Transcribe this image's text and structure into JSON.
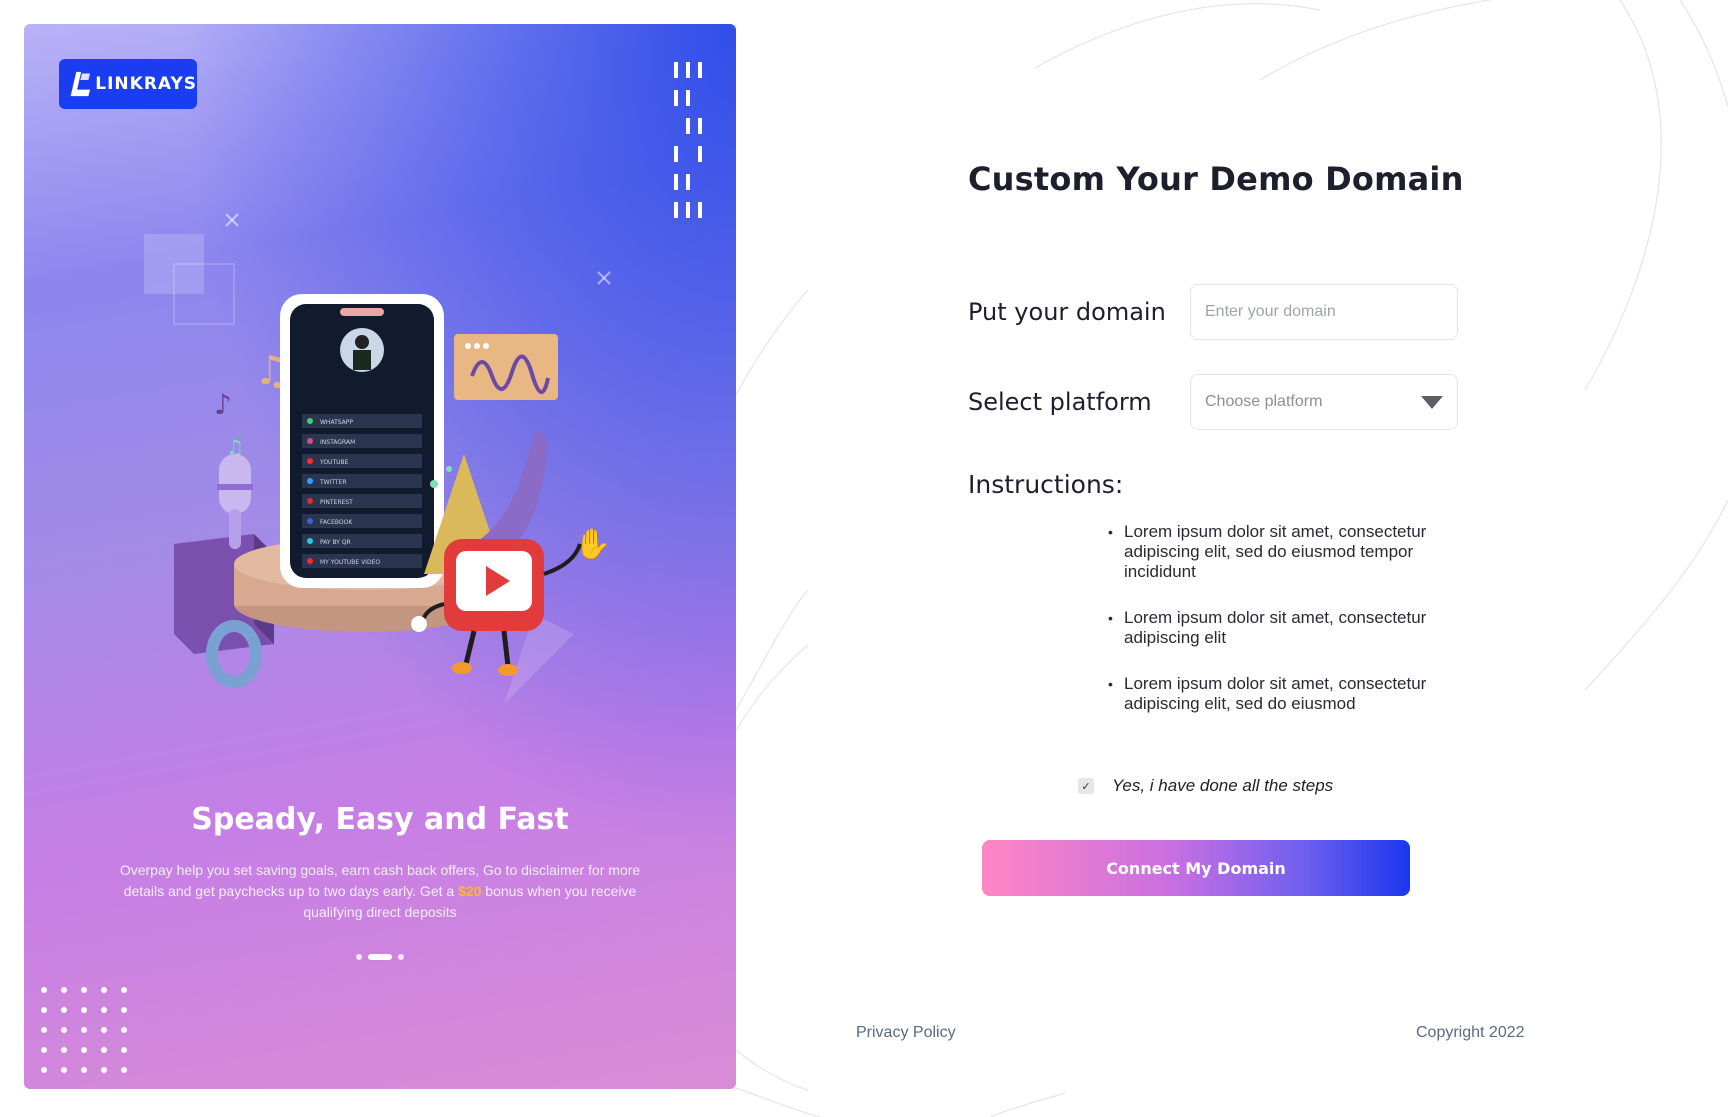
{
  "brand": {
    "name": "LINKRAYS"
  },
  "hero": {
    "title": "Speady, Easy and Fast",
    "description_before": "Overpay help you set saving goals, earn cash back offers, Go to disclaimer for more details and get paychecks up to two days early. Get a ",
    "bonus": "$20",
    "description_after": " bonus when you receive qualifying direct deposits",
    "carousel": {
      "total": 3,
      "active": 2
    },
    "phone_links": [
      "WHATSAPP",
      "INSTAGRAM",
      "YOUTUBE",
      "TWITTER",
      "PINTEREST",
      "FACEBOOK",
      "PAY BY QR",
      "MY YOUTUBE VIDEO"
    ]
  },
  "form": {
    "title": "Custom Your Demo Domain",
    "domain": {
      "label": "Put your domain",
      "placeholder": "Enter your domain",
      "value": ""
    },
    "platform": {
      "label": "Select platform",
      "placeholder": "Choose platform"
    },
    "instructions": {
      "title": "Instructions:",
      "items": [
        "Lorem ipsum dolor sit amet, consectetur adipiscing elit, sed do eiusmod tempor incididunt",
        "Lorem ipsum dolor sit amet, consectetur adipiscing elit",
        "Lorem ipsum dolor sit amet, consectetur adipiscing elit, sed do eiusmod"
      ]
    },
    "confirm": {
      "label": "Yes, i have done all the steps",
      "checked": true
    },
    "submit_label": "Connect My Domain"
  },
  "footer": {
    "privacy": "Privacy Policy",
    "copyright": "Copyright 2022"
  },
  "colors": {
    "brand": "#1b3df2",
    "bonus": "#ffb732",
    "footer_text": "#5a6a85"
  }
}
